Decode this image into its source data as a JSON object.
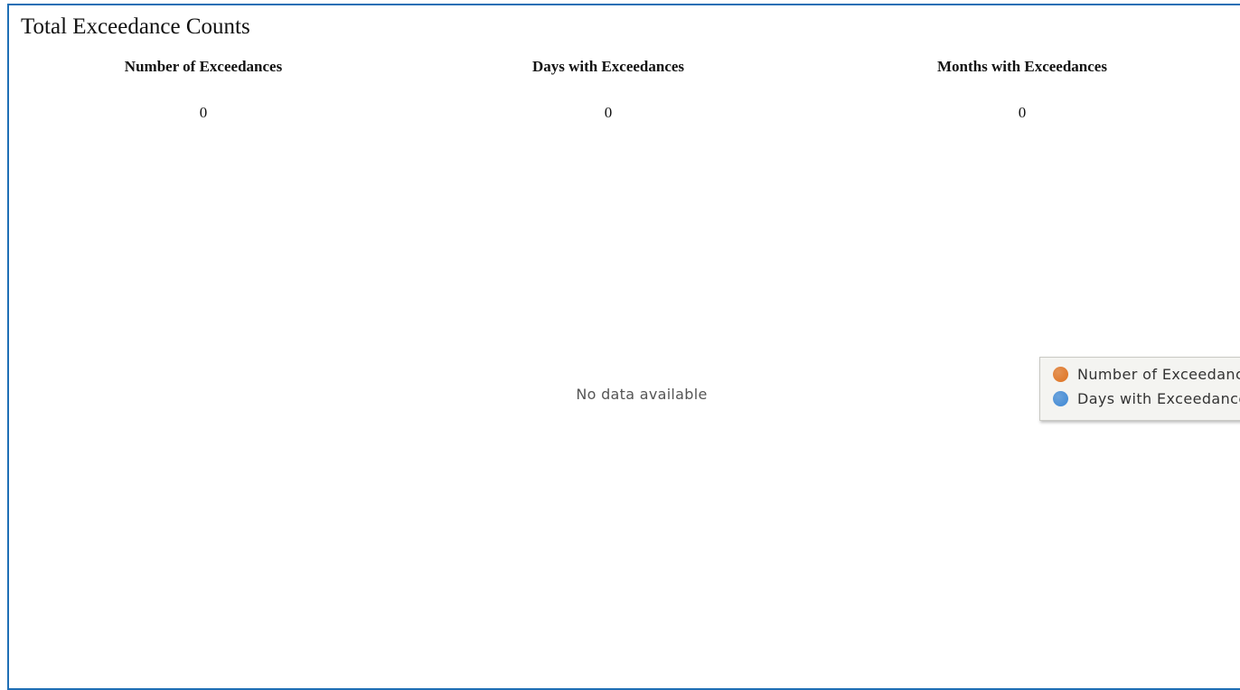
{
  "panel": {
    "title": "Total Exceedance Counts"
  },
  "stats": [
    {
      "label": "Number of Exceedances",
      "value": "0"
    },
    {
      "label": "Days with Exceedances",
      "value": "0"
    },
    {
      "label": "Months with Exceedances",
      "value": "0"
    }
  ],
  "chart": {
    "empty_message": "No data available",
    "legend": [
      {
        "label": "Number of Exceedances",
        "color": "#e07b2f",
        "icon": "orange-circle-icon"
      },
      {
        "label": "Days with Exceedances",
        "color": "#4a8fd6",
        "icon": "blue-circle-icon"
      }
    ]
  },
  "colors": {
    "panel_border": "#1f6fb5"
  }
}
